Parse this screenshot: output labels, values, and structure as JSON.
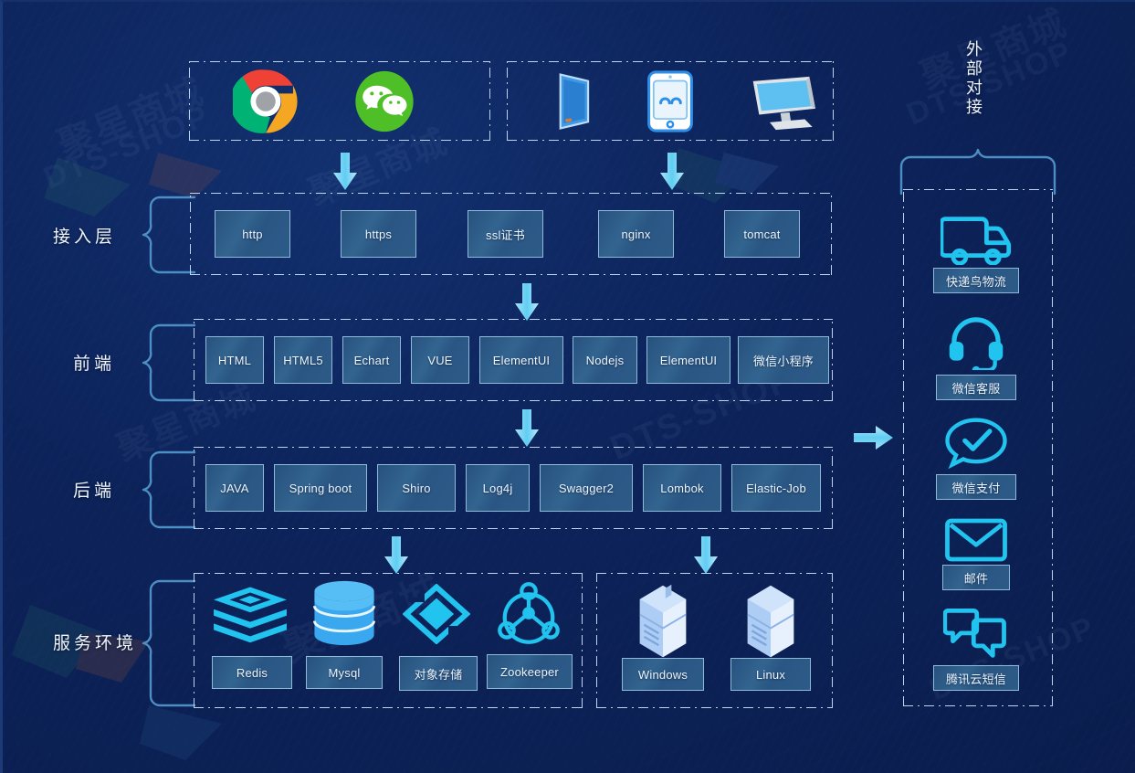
{
  "theme": {
    "bg": "#0c2259",
    "accent_cyan": "#24c1f0",
    "box_border": "#8fb8d9",
    "dash_border": "#bcd4ef",
    "text": "#eaf3ff"
  },
  "watermarks": [
    "聚星商城",
    "DTS-SHOP",
    "聚星商城",
    "DTS-SHOP",
    "聚星商城",
    "DTS-SHOP"
  ],
  "clients": {
    "browser_group": {
      "name": "browser-clients",
      "items": [
        {
          "label": "Chrome",
          "icon": "chrome-icon"
        },
        {
          "label": "WeChat",
          "icon": "wechat-icon"
        }
      ]
    },
    "device_group": {
      "name": "device-clients",
      "items": [
        {
          "label": "Phone",
          "icon": "phone-icon"
        },
        {
          "label": "Tablet",
          "icon": "tablet-icon"
        },
        {
          "label": "Desktop",
          "icon": "desktop-monitor-icon"
        }
      ]
    }
  },
  "layers": [
    {
      "id": "access",
      "label": "接入层",
      "items": [
        "http",
        "https",
        "ssl证书",
        "nginx",
        "tomcat"
      ]
    },
    {
      "id": "frontend",
      "label": "前端",
      "items": [
        "HTML",
        "HTML5",
        "Echart",
        "VUE",
        "ElementUI",
        "Nodejs",
        "ElementUI",
        "微信小程序"
      ]
    },
    {
      "id": "backend",
      "label": "后端",
      "items": [
        "JAVA",
        "Spring boot",
        "Shiro",
        "Log4j",
        "Swagger2",
        "Lombok",
        "Elastic-Job"
      ]
    },
    {
      "id": "service_env",
      "label": "服务环境",
      "groups": [
        {
          "name": "middleware",
          "items": [
            {
              "label": "Redis",
              "icon": "redis-stack-icon"
            },
            {
              "label": "Mysql",
              "icon": "database-cylinder-icon"
            },
            {
              "label": "对象存储",
              "icon": "object-storage-diamond-icon"
            },
            {
              "label": "Zookeeper",
              "icon": "zookeeper-node-icon"
            }
          ]
        },
        {
          "name": "operating-systems",
          "items": [
            {
              "label": "Windows",
              "icon": "server-tower-icon"
            },
            {
              "label": "Linux",
              "icon": "server-tower-icon"
            }
          ]
        }
      ]
    }
  ],
  "external": {
    "label": "外部对接",
    "items": [
      {
        "label": "快递鸟物流",
        "icon": "delivery-truck-icon"
      },
      {
        "label": "微信客服",
        "icon": "headset-icon"
      },
      {
        "label": "微信支付",
        "icon": "chat-check-icon"
      },
      {
        "label": "邮件",
        "icon": "envelope-icon"
      },
      {
        "label": "腾讯云短信",
        "icon": "sms-bubbles-icon"
      }
    ]
  },
  "flow_arrows": [
    {
      "name": "browser-to-access",
      "direction": "down"
    },
    {
      "name": "device-to-access",
      "direction": "down"
    },
    {
      "name": "access-to-frontend",
      "direction": "down"
    },
    {
      "name": "frontend-to-backend",
      "direction": "down"
    },
    {
      "name": "backend-to-middleware",
      "direction": "down"
    },
    {
      "name": "backend-to-os",
      "direction": "down"
    },
    {
      "name": "backend-to-external",
      "direction": "right"
    }
  ]
}
